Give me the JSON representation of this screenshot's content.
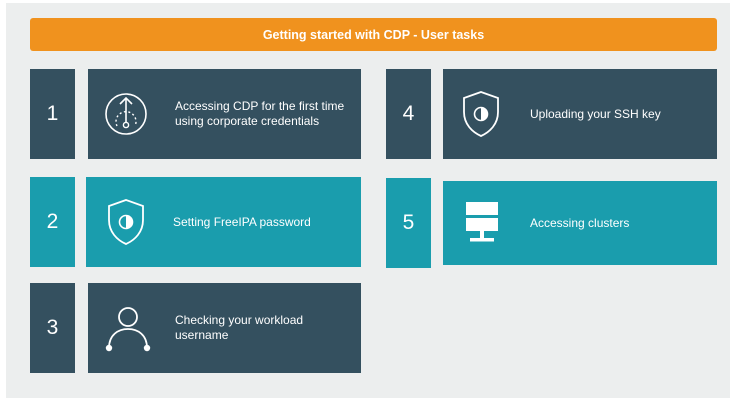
{
  "banner": {
    "title": "Getting started with CDP - User tasks"
  },
  "tasks": [
    {
      "number": "1",
      "label": "Accessing CDP for the first time using corporate credentials",
      "icon": "cloud-upload-icon"
    },
    {
      "number": "2",
      "label": "Setting FreeIPA password",
      "icon": "shield-icon"
    },
    {
      "number": "3",
      "label": "Checking your workload username",
      "icon": "user-icon"
    },
    {
      "number": "4",
      "label": "Uploading  your SSH key",
      "icon": "shield-icon"
    },
    {
      "number": "5",
      "label": "Accessing clusters",
      "icon": "server-icon"
    }
  ],
  "colors": {
    "banner": "#f0921e",
    "dark_tile": "#34505f",
    "teal_tile": "#1a9dad",
    "background": "#eceeee"
  }
}
